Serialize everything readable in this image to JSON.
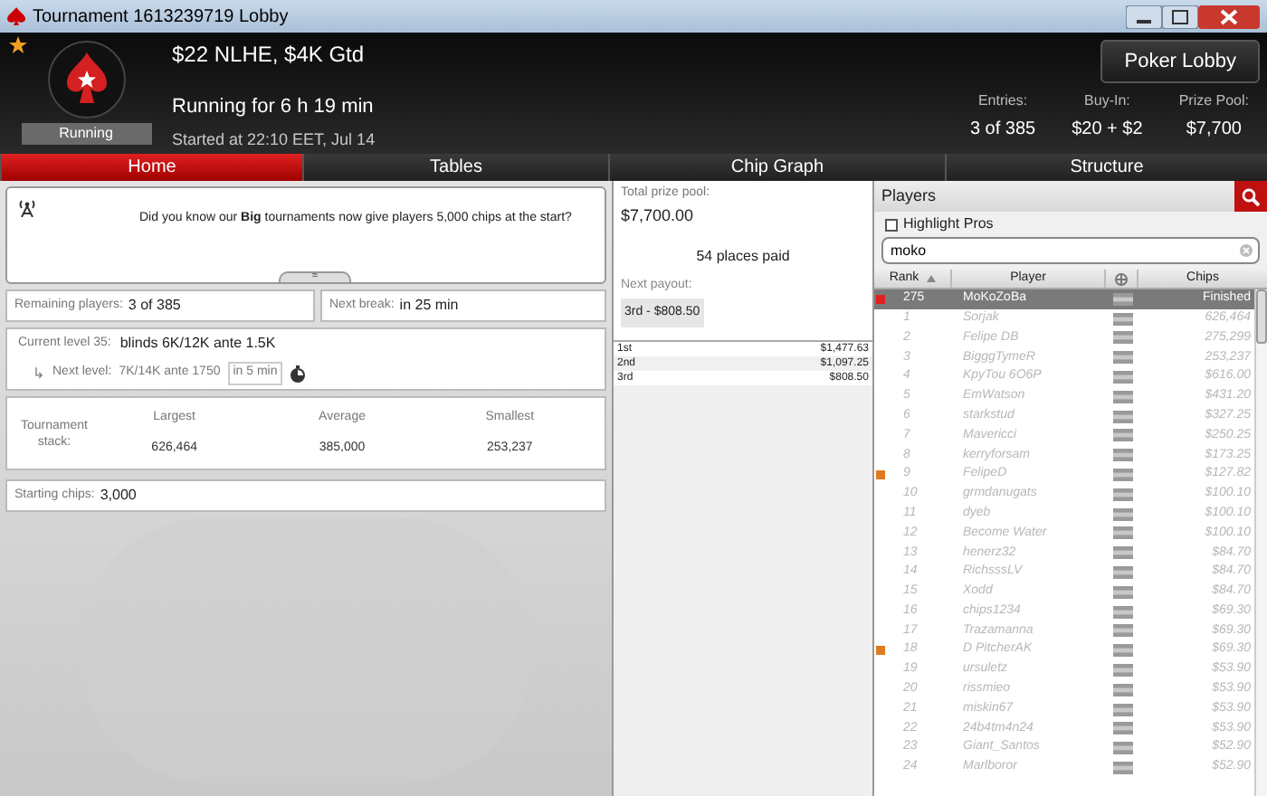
{
  "window": {
    "title": "Tournament 1613239719 Lobby"
  },
  "header": {
    "name": "$22 NLHE, $4K Gtd",
    "status": "Running",
    "running_for": "Running for 6 h 19 min",
    "started": "Started at 22:10 EET, Jul 14",
    "lobby_button": "Poker Lobby",
    "stats": [
      {
        "label": "Entries:",
        "value": "3 of 385"
      },
      {
        "label": "Buy-In:",
        "value": "$20 + $2"
      },
      {
        "label": "Prize Pool:",
        "value": "$7,700"
      }
    ]
  },
  "tabs": [
    {
      "label": "Home",
      "selected": true
    },
    {
      "label": "Tables",
      "selected": false
    },
    {
      "label": "Chip Graph",
      "selected": false
    },
    {
      "label": "Structure",
      "selected": false
    }
  ],
  "news": {
    "text": "Did you know our **Big** tournaments now give players 5,000 chips at the start?",
    "toggle": "≈"
  },
  "remaining": {
    "label": "Remaining players:",
    "value": "3 of 385"
  },
  "next_break": {
    "label": "Next break:",
    "value": "in 25 min"
  },
  "current_level": {
    "label": "Current level 35:",
    "value": "blinds 6K/12K ante 1.5K"
  },
  "next_level": {
    "arrow": "↳",
    "label": "Next level:",
    "value": "7K/14K ante 1750",
    "time": "in 5 min"
  },
  "stack": {
    "label": "Tournament stack:",
    "columns": [
      {
        "label": "Largest",
        "value": "626,464"
      },
      {
        "label": "Average",
        "value": "385,000"
      },
      {
        "label": "Smallest",
        "value": "253,237"
      }
    ]
  },
  "starting_chips": {
    "label": "Starting chips:",
    "value": "3,000"
  },
  "prizes": {
    "total_label": "Total prize pool:",
    "total": "$7,700.00",
    "places_paid": "54 places paid",
    "next_payout_label": "Next payout:",
    "next_payout": "3rd - $808.50",
    "rows": [
      {
        "place": "1st",
        "amount": "$1,477.63"
      },
      {
        "place": "2nd",
        "amount": "$1,097.25"
      },
      {
        "place": "3rd",
        "amount": "$808.50"
      }
    ]
  },
  "players": {
    "title": "Players",
    "highlight_pros": {
      "label": "Highlight Pros",
      "checked": false
    },
    "search": {
      "value": "moko"
    },
    "columns": [
      "Rank",
      "Player",
      "Chips"
    ],
    "rows": [
      {
        "rank": "275",
        "player": "MoKoZoBa",
        "chips": "Finished",
        "selected": true,
        "color": "#e02020"
      },
      {
        "rank": "1",
        "player": "Sorjak",
        "chips": "626,464",
        "selected": false
      },
      {
        "rank": "2",
        "player": "Felipe DB",
        "chips": "275,299",
        "selected": false
      },
      {
        "rank": "3",
        "player": "BigggTymeR",
        "chips": "253,237",
        "selected": false
      },
      {
        "rank": "4",
        "player": "KpyTou 6O6P",
        "chips": "$616.00",
        "selected": false
      },
      {
        "rank": "5",
        "player": "EmWatson",
        "chips": "$431.20",
        "selected": false
      },
      {
        "rank": "6",
        "player": "starkstud",
        "chips": "$327.25",
        "selected": false
      },
      {
        "rank": "7",
        "player": "Mavericci",
        "chips": "$250.25",
        "selected": false
      },
      {
        "rank": "8",
        "player": "kerryforsam",
        "chips": "$173.25",
        "selected": false
      },
      {
        "rank": "9",
        "player": "FelipeD",
        "chips": "$127.82",
        "selected": false,
        "color": "#e07a20"
      },
      {
        "rank": "10",
        "player": "grmdanugats",
        "chips": "$100.10",
        "selected": false
      },
      {
        "rank": "11",
        "player": "dyeb",
        "chips": "$100.10",
        "selected": false
      },
      {
        "rank": "12",
        "player": "Become Water",
        "chips": "$100.10",
        "selected": false
      },
      {
        "rank": "13",
        "player": "henerz32",
        "chips": "$84.70",
        "selected": false
      },
      {
        "rank": "14",
        "player": "RichsssLV",
        "chips": "$84.70",
        "selected": false
      },
      {
        "rank": "15",
        "player": "Xodd",
        "chips": "$84.70",
        "selected": false
      },
      {
        "rank": "16",
        "player": "chips1234",
        "chips": "$69.30",
        "selected": false
      },
      {
        "rank": "17",
        "player": "Trazamanna",
        "chips": "$69.30",
        "selected": false
      },
      {
        "rank": "18",
        "player": "D PitcherAK",
        "chips": "$69.30",
        "selected": false,
        "color": "#e07a20"
      },
      {
        "rank": "19",
        "player": "ursuletz",
        "chips": "$53.90",
        "selected": false
      },
      {
        "rank": "20",
        "player": "rissmieo",
        "chips": "$53.90",
        "selected": false
      },
      {
        "rank": "21",
        "player": "miskin67",
        "chips": "$53.90",
        "selected": false
      },
      {
        "rank": "22",
        "player": "24b4tm4n24",
        "chips": "$53.90",
        "selected": false
      },
      {
        "rank": "23",
        "player": "Giant_Santos",
        "chips": "$52.90",
        "selected": false
      },
      {
        "rank": "24",
        "player": "Marlboror",
        "chips": "$52.90",
        "selected": false
      }
    ]
  }
}
